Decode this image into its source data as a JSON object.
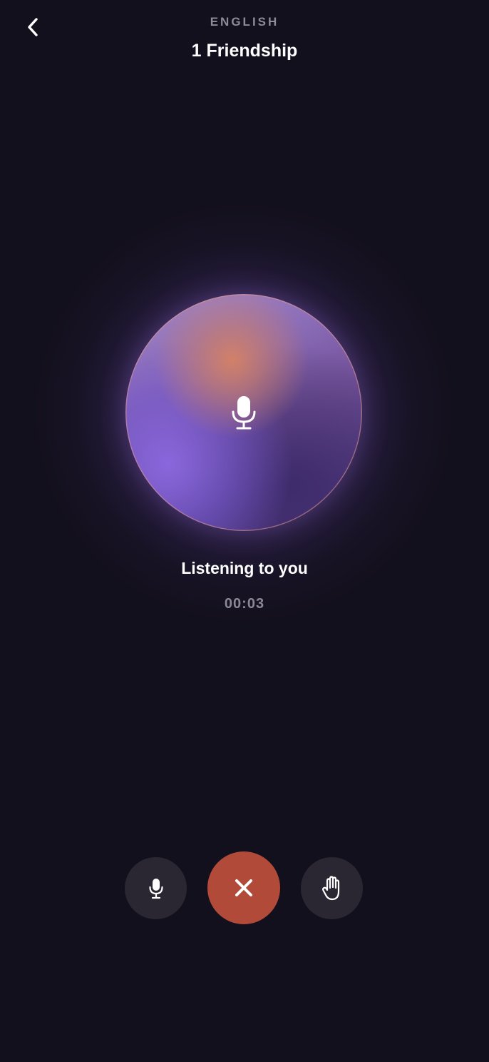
{
  "header": {
    "language": "ENGLISH",
    "title": "1 Friendship",
    "back_icon": "chevron-left-icon"
  },
  "orb": {
    "icon": "microphone-icon"
  },
  "status": {
    "label": "Listening to you",
    "timer": "00:03"
  },
  "controls": [
    {
      "name": "mute-microphone",
      "icon": "microphone-icon"
    },
    {
      "name": "end-call",
      "icon": "close-icon",
      "color": "#b24a3a"
    },
    {
      "name": "raise-hand",
      "icon": "hand-icon"
    }
  ],
  "colors": {
    "background": "#13101d",
    "accent_end": "#b24a3a",
    "button_bg": "#2a2733"
  }
}
